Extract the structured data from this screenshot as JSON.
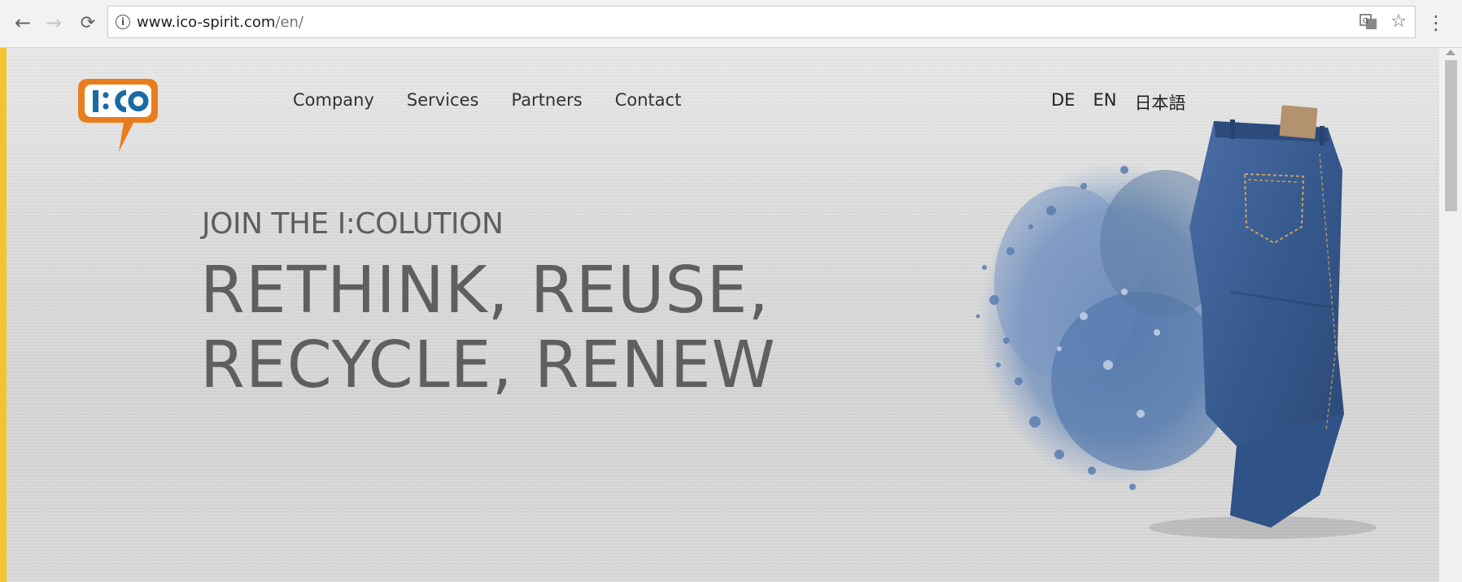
{
  "browser": {
    "url_host": "www.ico-spirit.com",
    "url_path": "/en/",
    "icons": [
      "back-arrow-icon",
      "forward-arrow-icon",
      "reload-icon",
      "info-icon",
      "translate-icon",
      "star-icon",
      "menu-icon"
    ]
  },
  "site": {
    "logo_text": "I:CO",
    "nav": [
      "Company",
      "Services",
      "Partners",
      "Contact"
    ],
    "languages": [
      "DE",
      "EN",
      "日本語"
    ],
    "eyebrow": "JOIN THE I:COLUTION",
    "headline_line1": "RETHINK, REUSE,",
    "headline_line2": "RECYCLE, RENEW"
  },
  "colors": {
    "logo_orange": "#e87d1e",
    "logo_blue": "#1b6aa5",
    "text_gray": "#5f5f5f",
    "denim": "#3a5f93"
  }
}
